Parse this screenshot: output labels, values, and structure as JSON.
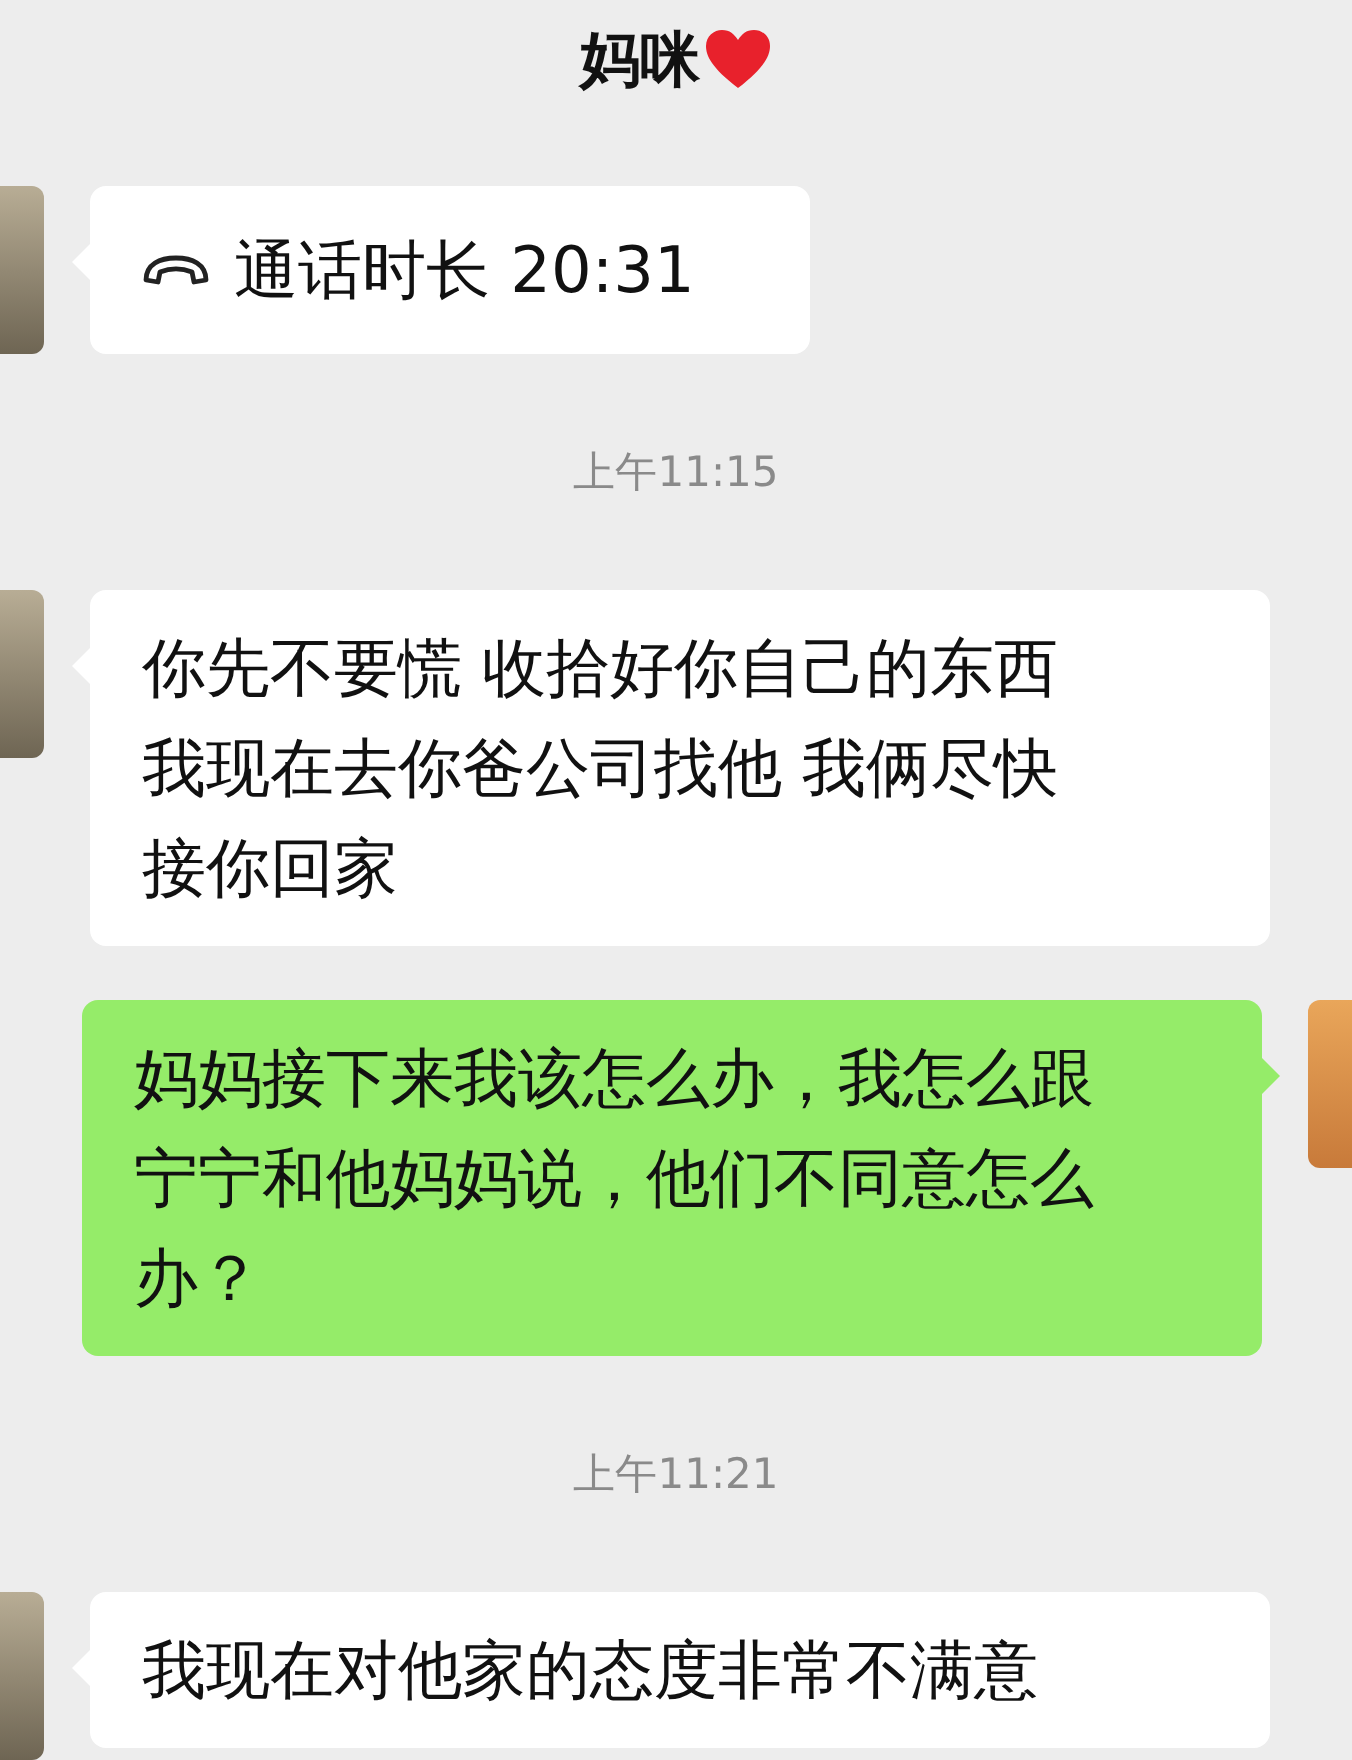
{
  "header": {
    "title": "妈咪"
  },
  "messages": [
    {
      "kind": "call",
      "outgoing": false,
      "lines": [
        "通话时长 20:31"
      ]
    },
    {
      "kind": "time",
      "lines": [
        "上午11:15"
      ]
    },
    {
      "kind": "text",
      "outgoing": false,
      "lines": [
        "你先不要慌 收拾好你自己的东西",
        "我现在去你爸公司找他 我俩尽快",
        "接你回家"
      ]
    },
    {
      "kind": "text",
      "outgoing": true,
      "lines": [
        "妈妈接下来我该怎么办，我怎么跟",
        "宁宁和他妈妈说，他们不同意怎么",
        "办？"
      ]
    },
    {
      "kind": "time",
      "lines": [
        "上午11:21"
      ]
    },
    {
      "kind": "text",
      "outgoing": false,
      "lines": [
        "我现在对他家的态度非常不满意"
      ]
    }
  ]
}
